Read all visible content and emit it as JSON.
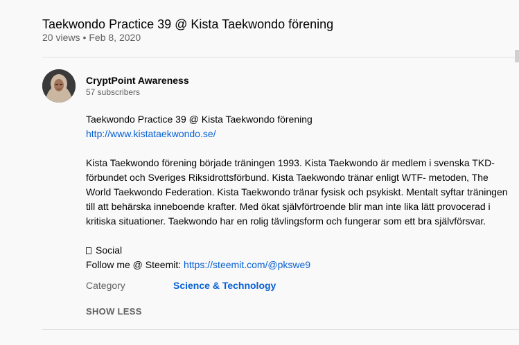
{
  "video": {
    "title": "Taekwondo Practice 39 @ Kista Taekwondo förening",
    "views": "20 views",
    "separator": "•",
    "date": "Feb 8, 2020"
  },
  "channel": {
    "name": "CryptPoint Awareness",
    "subscribers": "57 subscribers",
    "avatar_icon": "avatar-woman-hijab"
  },
  "description": {
    "line1": "Taekwondo Practice 39 @ Kista Taekwondo förening",
    "link1": "http://www.kistataekwondo.se/",
    "paragraph_lines": [
      "Kista Taekwondo förening började träningen 1993. Kista Taekwondo är medlem i svenska TKD-",
      "förbundet och Sveriges Riksidrottsförbund. Kista Taekwondo tränar enligt WTF- metoden, The",
      "World Taekwondo Federation. Kista Taekwondo tränar fysisk och psykiskt. Mentalt syftar träningen",
      "till att behärska inneboende krafter. Med ökat självförtroende blir man inte lika lätt provocerad i",
      "kritiska situationer. Taekwondo har en rolig tävlingsform och fungerar som ett bra självförsvar."
    ],
    "social_label": "Social",
    "social_glyph": "missing-glyph-box",
    "follow_prefix": "Follow me @ Steemit: ",
    "follow_link": "https://steemit.com/@pkswe9"
  },
  "metadata": {
    "category_label": "Category",
    "category_value": "Science & Technology"
  },
  "actions": {
    "show_less": "SHOW LESS"
  },
  "colors": {
    "link": "#065fd4",
    "secondary_text": "#606060",
    "primary_text": "#030303",
    "background": "#f9f9f9",
    "divider": "#e0e0e0"
  }
}
